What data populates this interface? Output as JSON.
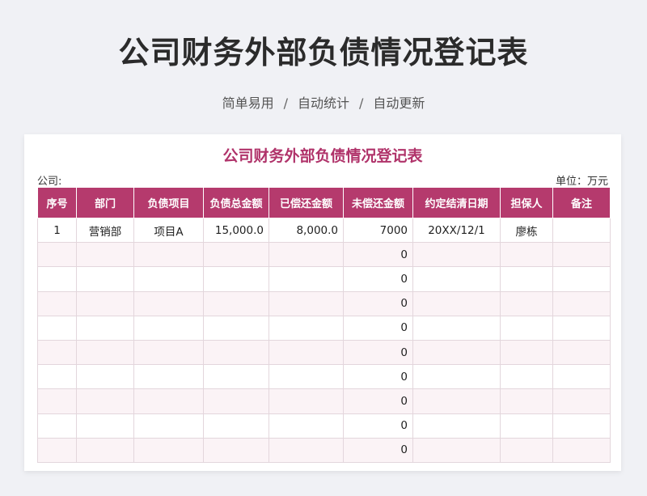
{
  "header": {
    "title": "公司财务外部负债情况登记表",
    "subtitle": [
      "简单易用",
      "自动统计",
      "自动更新"
    ],
    "separator": "/"
  },
  "sheet": {
    "title": "公司财务外部负债情况登记表",
    "company_label": "公司:",
    "unit_label": "单位：万元",
    "columns": [
      "序号",
      "部门",
      "负债项目",
      "负债总金额",
      "已偿还金额",
      "未偿还金额",
      "约定结清日期",
      "担保人",
      "备注"
    ],
    "rows": [
      [
        "1",
        "营销部",
        "项目A",
        "15,000.0",
        "8,000.0",
        "7000",
        "20XX/12/1",
        "廖栋",
        ""
      ],
      [
        "",
        "",
        "",
        "",
        "",
        "0",
        "",
        "",
        ""
      ],
      [
        "",
        "",
        "",
        "",
        "",
        "0",
        "",
        "",
        ""
      ],
      [
        "",
        "",
        "",
        "",
        "",
        "0",
        "",
        "",
        ""
      ],
      [
        "",
        "",
        "",
        "",
        "",
        "0",
        "",
        "",
        ""
      ],
      [
        "",
        "",
        "",
        "",
        "",
        "0",
        "",
        "",
        ""
      ],
      [
        "",
        "",
        "",
        "",
        "",
        "0",
        "",
        "",
        ""
      ],
      [
        "",
        "",
        "",
        "",
        "",
        "0",
        "",
        "",
        ""
      ],
      [
        "",
        "",
        "",
        "",
        "",
        "0",
        "",
        "",
        ""
      ],
      [
        "",
        "",
        "",
        "",
        "",
        "0",
        "",
        "",
        ""
      ]
    ]
  }
}
